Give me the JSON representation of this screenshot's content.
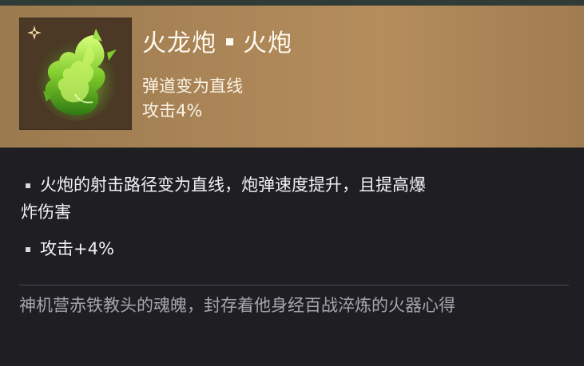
{
  "item": {
    "title_main": "火龙炮",
    "title_type": "火炮",
    "subtitle_1": "弹道变为直线",
    "subtitle_2": "攻击4%",
    "icon": "green-flame-relic-icon",
    "corner_icon": "sparkle-icon"
  },
  "effects": {
    "bullet_1_line_1": "火炮的射击路径变为直线，炮弹速度提升，且提高爆",
    "bullet_1_line_2": "炸伤害",
    "bullet_2": "攻击+4%"
  },
  "lore": {
    "text": "神机营赤铁教头的魂魄，封存着他身经百战淬炼的火器心得"
  },
  "colors": {
    "header_gold": "#a98456",
    "panel_dark": "#1e1e23",
    "flame_green": "#8fd43a"
  }
}
